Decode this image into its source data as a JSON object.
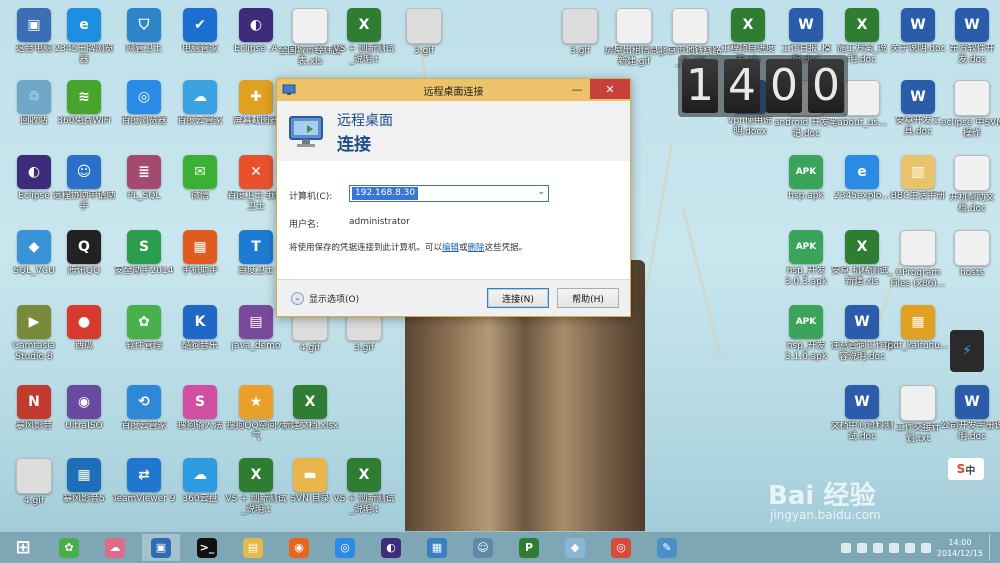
{
  "dialog": {
    "title": "远程桌面连接",
    "banner_line1": "远程桌面",
    "banner_line2": "连接",
    "computer_label": "计算机(C):",
    "computer_value": "192.168.8.30",
    "username_label": "用户名:",
    "username_value": "administrator",
    "saved_prefix": "将使用保存的凭据连接到此计算机。可以",
    "saved_edit": "编辑",
    "saved_or": "或",
    "saved_delete": "删除",
    "saved_suffix": "这些凭据。",
    "show_options": "显示选项(O)",
    "connect_button": "连接(N)",
    "help_button": "帮助(H)"
  },
  "clock_widget": {
    "digits": [
      "1",
      "4",
      "0",
      "0"
    ]
  },
  "desktop_icons": [
    {
      "label": "这台电脑",
      "color": "#3b6fb5",
      "glyph": "▣"
    },
    {
      "label": "2345王牌浏览器",
      "color": "#1c8fe0",
      "glyph": "e"
    },
    {
      "label": "网管卫士",
      "color": "#2d84c8",
      "glyph": "⛉"
    },
    {
      "label": "电脑管家",
      "color": "#1a6fd1",
      "glyph": "✔"
    },
    {
      "label": "Eclipse .A",
      "color": "#3d2c7a",
      "glyph": "◐"
    },
    {
      "label": "全国城市经纬度表.xls",
      "color": "#f0f0f0",
      "glyph": ""
    },
    {
      "label": "VS + 创新测试_说明.t",
      "color": "#2e7d32",
      "glyph": "X"
    },
    {
      "label": "3.gif",
      "color": "#ddd",
      "glyph": ""
    },
    {
      "label": "回收站",
      "color": "#6fa7c9",
      "glyph": "♲"
    },
    {
      "label": "360免费WiFi",
      "color": "#48a52c",
      "glyph": "≋"
    },
    {
      "label": "百度浏览器",
      "color": "#2a8be6",
      "glyph": "◎"
    },
    {
      "label": "百度云管家",
      "color": "#3aa2e0",
      "glyph": "☁"
    },
    {
      "label": "屏幕截图器",
      "color": "#e0a020",
      "glyph": "✚"
    },
    {
      "label": "Eclipse",
      "color": "#3d2c7a",
      "glyph": "◐"
    },
    {
      "label": "远程协助申请助手",
      "color": "#2a72c9",
      "glyph": "☺"
    },
    {
      "label": "PL_SQL",
      "color": "#a54a6f",
      "glyph": "≣"
    },
    {
      "label": "微信",
      "color": "#3cb034",
      "glyph": "✉"
    },
    {
      "label": "百度卫士-我的卫士",
      "color": "#e7522c",
      "glyph": "✕"
    },
    {
      "label": "SQL_VCU",
      "color": "#3a93d6",
      "glyph": "◆"
    },
    {
      "label": "腾讯QQ",
      "color": "#222",
      "glyph": "Q"
    },
    {
      "label": "安全助手2014",
      "color": "#2a9d4f",
      "glyph": "S"
    },
    {
      "label": "手机助手",
      "color": "#e05b20",
      "glyph": "▦"
    },
    {
      "label": "百度卫士",
      "color": "#1f7ad1",
      "glyph": "T"
    },
    {
      "label": "Camtasia Studio 8",
      "color": "#7a8a3c",
      "glyph": "▶"
    },
    {
      "label": "西瓜",
      "color": "#d73a2e",
      "glyph": "●"
    },
    {
      "label": "软件管理",
      "color": "#48b04a",
      "glyph": "✿"
    },
    {
      "label": "酷狗音乐",
      "color": "#1f68c7",
      "glyph": "K"
    },
    {
      "label": "java_demo",
      "color": "#7a4a9a",
      "glyph": "▤"
    },
    {
      "label": "4.gif",
      "color": "#ddd",
      "glyph": ""
    },
    {
      "label": "3.gif",
      "color": "#ddd",
      "glyph": ""
    },
    {
      "label": "暴风影音",
      "color": "#c33a2e",
      "glyph": "N"
    },
    {
      "label": "UltraISO",
      "color": "#6a4aa0",
      "glyph": "◉"
    },
    {
      "label": "百度云管家",
      "color": "#2d88d8",
      "glyph": "⟲"
    },
    {
      "label": "搜狗输入法",
      "color": "#d24ea0",
      "glyph": "S"
    },
    {
      "label": "搜狗QQ空间人气",
      "color": "#e8a02a",
      "glyph": "★"
    },
    {
      "label": "新建文档.xlsx",
      "color": "#2e7d32",
      "glyph": "X"
    },
    {
      "label": "4.gif",
      "color": "#ddd",
      "glyph": ""
    },
    {
      "label": "暴风影音5",
      "color": "#1e6fb8",
      "glyph": "▦"
    },
    {
      "label": "TeamViewer 9",
      "color": "#1f77d0",
      "glyph": "⇄"
    },
    {
      "label": "360云盘",
      "color": "#2d9be0",
      "glyph": "☁"
    },
    {
      "label": "VS + 创新测试_说明.t",
      "color": "#2e7d32",
      "glyph": "X"
    },
    {
      "label": "SVN 目录",
      "color": "#e8b64a",
      "glyph": "▬"
    },
    {
      "label": "VS + 创新测试_说明.t",
      "color": "#2e7d32",
      "glyph": "X"
    },
    {
      "label": "3.gif",
      "color": "#ddd",
      "glyph": ""
    },
    {
      "label": "房屋出租信息_新建.gif",
      "color": "#f0f0f0",
      "glyph": ""
    },
    {
      "label": "北京市地铁线路_小.gif",
      "color": "#f0f0f0",
      "glyph": ""
    },
    {
      "label": "工程项目进度表.xls",
      "color": "#2e7d32",
      "glyph": "X"
    },
    {
      "label": "工作日报_模板.doc",
      "color": "#2a5caa",
      "glyph": "W"
    },
    {
      "label": "施工方案_说明.doc",
      "color": "#2e7d32",
      "glyph": "X"
    },
    {
      "label": "关于说明.doc",
      "color": "#2a5caa",
      "glyph": "W"
    },
    {
      "label": "东方软件开发.doc",
      "color": "#2a5caa",
      "glyph": "W"
    },
    {
      "label": "vpn使用说明.docx",
      "color": "#2a5caa",
      "glyph": "W"
    },
    {
      "label": "android 开发笔记.doc",
      "color": "#f0f0f0",
      "glyph": ""
    },
    {
      "label": "about_us...",
      "color": "#f0f0f0",
      "glyph": ""
    },
    {
      "label": "安卓开发工具.doc",
      "color": "#2a5caa",
      "glyph": "W"
    },
    {
      "label": "eclipse 中SVN操作",
      "color": "#f0f0f0",
      "glyph": ""
    },
    {
      "label": "hsp.apk",
      "color": "#3aa55a",
      "glyph": "APK"
    },
    {
      "label": "2345explo...",
      "color": "#2a8be6",
      "glyph": "e"
    },
    {
      "label": "BBC生活手册",
      "color": "#e8c36a",
      "glyph": "▥"
    },
    {
      "label": "开机帮助文档.doc",
      "color": "#f0f0f0",
      "glyph": ""
    },
    {
      "label": "hsp_开发3.0.3.apk",
      "color": "#3aa55a",
      "glyph": "APK"
    },
    {
      "label": "安卓 机械测试_新建.xls",
      "color": "#2e7d32",
      "glyph": "X"
    },
    {
      "label": "CProgram Files (x86)...",
      "color": "#f0f0f0",
      "glyph": ""
    },
    {
      "label": "hosts",
      "color": "#f0f0f0",
      "glyph": ""
    },
    {
      "label": "hsp_开发3.1.0.apk",
      "color": "#3aa55a",
      "glyph": "APK"
    },
    {
      "label": "注意查询工作内容说明.doc",
      "color": "#2a5caa",
      "glyph": "W"
    },
    {
      "label": "pdf_kaifuhu...",
      "color": "#e0a020",
      "glyph": "▦"
    },
    {
      "label": "文档中心资料测试.doc",
      "color": "#2a5caa",
      "glyph": "W"
    },
    {
      "label": "工作交接计划.txt",
      "color": "#f0f0f0",
      "glyph": ""
    },
    {
      "label": "公司开发手册说明.doc",
      "color": "#2a5caa",
      "glyph": "W"
    },
    {
      "label": "关于测试的说明.doc",
      "color": "#2a5caa",
      "glyph": "W"
    },
    {
      "label": "手机说明书.jpg",
      "color": "#f0f0f0",
      "glyph": ""
    }
  ],
  "taskbar": {
    "items": [
      {
        "name": "start-button",
        "glyph": "⊞",
        "color": "transparent"
      },
      {
        "name": "taskbar-app-pinwheel",
        "glyph": "✿",
        "color": "#48b04a"
      },
      {
        "name": "taskbar-app-cloud",
        "glyph": "☁",
        "color": "#e06a8a"
      },
      {
        "name": "taskbar-app-remote-desktop",
        "glyph": "▣",
        "color": "#2d6db5"
      },
      {
        "name": "taskbar-app-cmd",
        "glyph": ">_",
        "color": "#111"
      },
      {
        "name": "taskbar-app-explorer",
        "glyph": "▤",
        "color": "#e3b94a"
      },
      {
        "name": "taskbar-app-firefox",
        "glyph": "◉",
        "color": "#e8651e"
      },
      {
        "name": "taskbar-app-browser",
        "glyph": "◎",
        "color": "#2a8be6"
      },
      {
        "name": "taskbar-app-eclipse",
        "glyph": "◐",
        "color": "#3d2c7a"
      },
      {
        "name": "taskbar-app-network",
        "glyph": "▦",
        "color": "#3a80c0"
      },
      {
        "name": "taskbar-app-photo",
        "glyph": "☺",
        "color": "#5c8aa8"
      },
      {
        "name": "taskbar-app-project",
        "glyph": "P",
        "color": "#2f7d32"
      },
      {
        "name": "taskbar-app-sketch",
        "glyph": "◆",
        "color": "#8ab6d6"
      },
      {
        "name": "taskbar-app-chrome",
        "glyph": "◎",
        "color": "#d84a3a"
      },
      {
        "name": "taskbar-app-paint",
        "glyph": "✎",
        "color": "#4a90c8"
      }
    ],
    "time": "14:00",
    "date": "2014/12/15"
  },
  "watermark": {
    "text": "Bai 经验",
    "url": "jingyan.baidu.com"
  },
  "colors": {
    "titlebar": "#ecc36a",
    "close": "#c7403a",
    "banner_text": "#1d4c8c",
    "selection": "#3875d7"
  }
}
